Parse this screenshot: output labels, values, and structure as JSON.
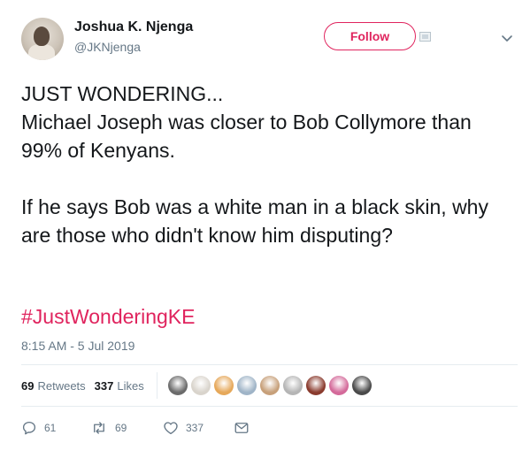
{
  "tweet": {
    "author": {
      "name": "Joshua K. Njenga",
      "handle": "@JKNjenga"
    },
    "follow_label": "Follow",
    "text": "JUST WONDERING...\nMichael Joseph was closer to Bob Collymore than 99% of Kenyans.\n\nIf he says Bob was a white man in a black skin, why are those who didn't know him disputing?",
    "hashtag": "#JustWonderingKE",
    "timestamp": "8:15 AM - 5 Jul 2019"
  },
  "stats": {
    "retweets_count": "69",
    "retweets_label": "Retweets",
    "likes_count": "337",
    "likes_label": "Likes"
  },
  "likers": [
    {
      "color": "#6b6b6b"
    },
    {
      "color": "#d9d4cc"
    },
    {
      "color": "#e6a85a"
    },
    {
      "color": "#9fb4c7"
    },
    {
      "color": "#c7a07a"
    },
    {
      "color": "#b5b5b5"
    },
    {
      "color": "#8a3b2e"
    },
    {
      "color": "#d46a9a"
    },
    {
      "color": "#4a4a4a"
    }
  ],
  "actions": {
    "reply_count": "61",
    "retweet_count": "69",
    "like_count": "337"
  },
  "colors": {
    "accent": "#e0245e",
    "muted": "#657786",
    "text": "#14171a"
  }
}
